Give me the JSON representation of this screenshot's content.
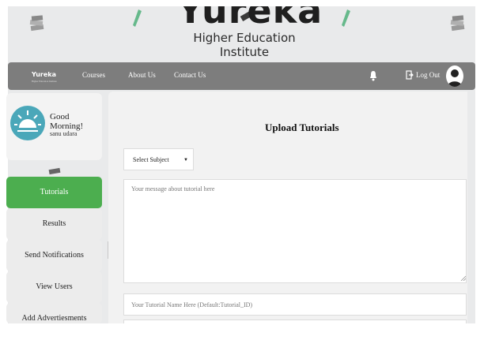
{
  "brand": {
    "logo_word": "Yureka",
    "logo_subtitle": "Higher Education Institute",
    "nav_logo": "Yureka",
    "nav_logo_sub": "Higher Education Institute"
  },
  "nav": {
    "links": [
      "Courses",
      "About Us",
      "Contact Us"
    ],
    "logout_label": "Log Out"
  },
  "profile": {
    "greeting": "Good Morning!",
    "username": "sanu udara"
  },
  "sidebar": {
    "items": [
      {
        "label": "Tutorials",
        "active": true
      },
      {
        "label": "Results",
        "active": false
      },
      {
        "label": "Send Notifications",
        "active": false
      },
      {
        "label": "View Users",
        "active": false
      },
      {
        "label": "Add Advertiesments",
        "active": false
      }
    ]
  },
  "main": {
    "title": "Upload Tutorials",
    "subject_select": "Select Subject",
    "message_placeholder": "Your message about tutorial here",
    "name_placeholder": "Your Tutorial Name Here (Default:Tutorial_ID)"
  },
  "colors": {
    "navbar": "#7d7d7d",
    "active": "#4cae4f",
    "sun": "#4aa7b9"
  }
}
